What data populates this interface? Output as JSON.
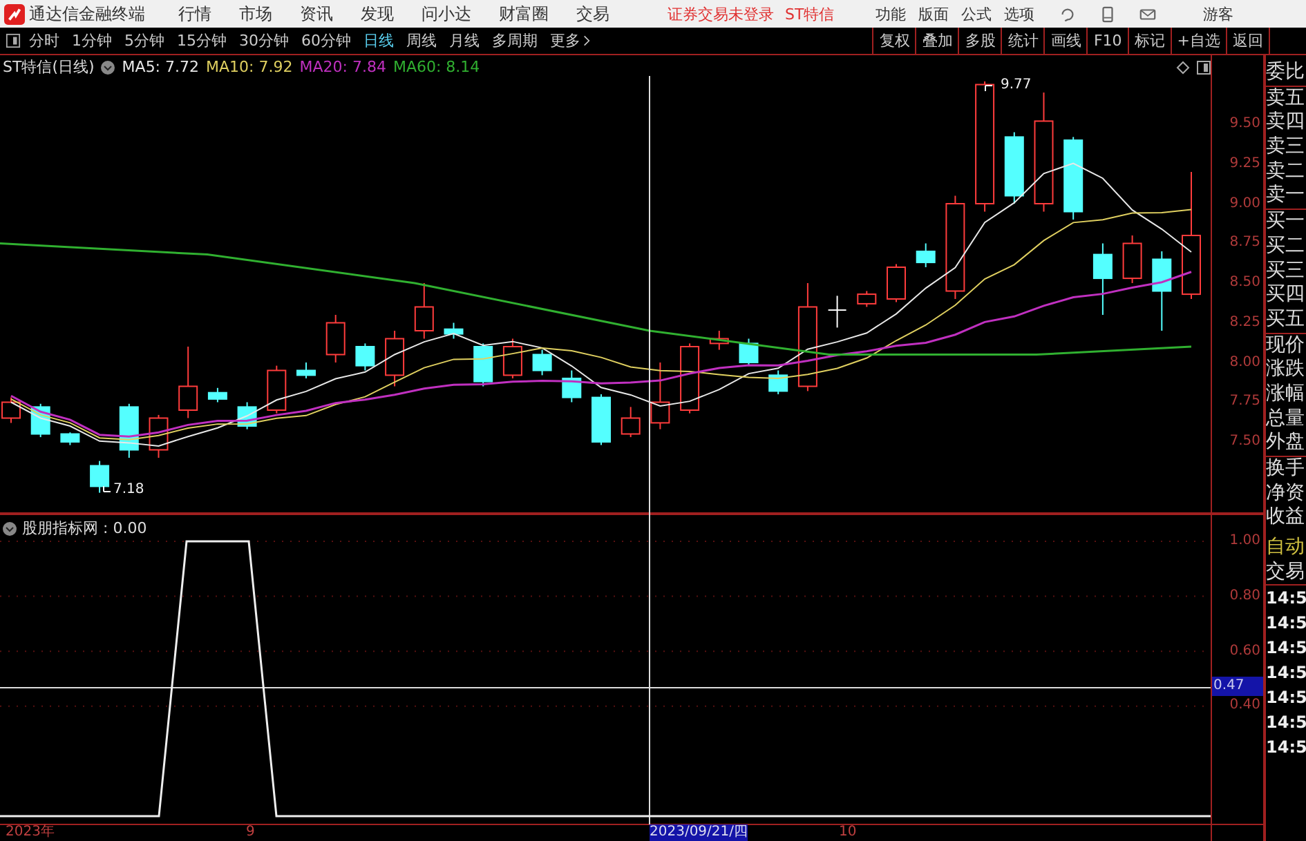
{
  "app": {
    "title": "通达信金融终端"
  },
  "menu": [
    "行情",
    "市场",
    "资讯",
    "发现",
    "问小达",
    "财富圈",
    "交易"
  ],
  "login_status": "证券交易未登录",
  "stock_name": "ST特信",
  "menu_right": [
    "功能",
    "版面",
    "公式",
    "选项"
  ],
  "user": "游客",
  "periods": [
    {
      "label": "分时",
      "selected": false
    },
    {
      "label": "1分钟",
      "selected": false
    },
    {
      "label": "5分钟",
      "selected": false
    },
    {
      "label": "15分钟",
      "selected": false
    },
    {
      "label": "30分钟",
      "selected": false
    },
    {
      "label": "60分钟",
      "selected": false
    },
    {
      "label": "日线",
      "selected": true
    },
    {
      "label": "周线",
      "selected": false
    },
    {
      "label": "月线",
      "selected": false
    },
    {
      "label": "多周期",
      "selected": false
    }
  ],
  "more": "更多",
  "tools": [
    "复权",
    "叠加",
    "多股",
    "统计",
    "画线",
    "F10",
    "标记",
    "+自选",
    "返回"
  ],
  "main_chart": {
    "title": "ST特信(日线)",
    "ma": [
      {
        "label": "MA5: 7.72",
        "color": "#e8e8e8"
      },
      {
        "label": "MA10: 7.92",
        "color": "#e0d060"
      },
      {
        "label": "MA20: 7.84",
        "color": "#c030c0"
      },
      {
        "label": "MA60: 8.14",
        "color": "#30b030"
      }
    ],
    "high_label": "9.77",
    "low_label": "7.18",
    "yticks": [
      "9.50",
      "9.25",
      "9.00",
      "8.75",
      "8.50",
      "8.25",
      "8.00",
      "7.75",
      "7.50"
    ]
  },
  "indicator": {
    "title": "股朋指标网 : 0.00",
    "yticks": [
      "1.00",
      "0.80",
      "0.60",
      "0.40"
    ],
    "cursor_value": "0.47"
  },
  "xaxis": {
    "labels": [
      "2023年",
      "9",
      "10"
    ],
    "cursor_date": "2023/09/21/四"
  },
  "quote_panel": {
    "rows": [
      "委比",
      "卖五",
      "卖四",
      "卖三",
      "卖二",
      "卖一",
      "买一",
      "买二",
      "买三",
      "买四",
      "买五",
      "现价",
      "涨跌",
      "涨幅",
      "总量",
      "外盘",
      "换手",
      "净资",
      "收益"
    ],
    "auto": "自动",
    "trade": "交易",
    "times": [
      "14:5",
      "14:5",
      "14:5",
      "14:5",
      "14:5",
      "14:5",
      "14:5"
    ]
  }
}
